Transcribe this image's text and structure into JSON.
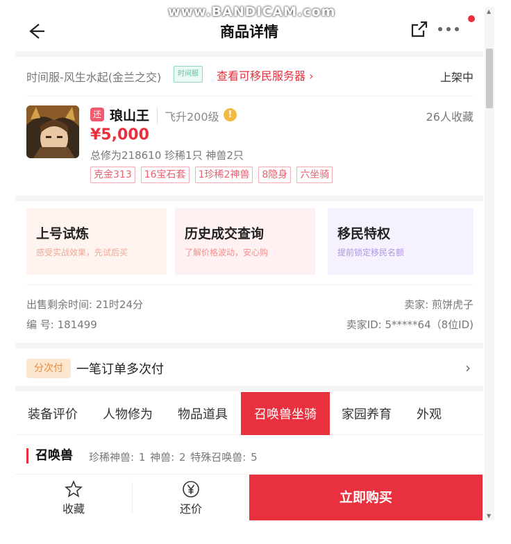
{
  "watermark": "www.BANDICAM.com",
  "header": {
    "title": "商品详情"
  },
  "server": {
    "name": "时间服-风生水起(金兰之交)",
    "tag": "时间服",
    "link": "查看可移民服务器 ›",
    "status": "上架中"
  },
  "product": {
    "return_badge": "还",
    "name": "琅山王",
    "level": "飞升200级",
    "fav_count": "26人收藏",
    "price": "¥5,000",
    "stats": "总修为218610 珍稀1只 神兽2只",
    "tags": [
      "克金313",
      "16宝石套",
      "1珍稀2神兽",
      "8隐身",
      "六坐骑"
    ]
  },
  "cards": [
    {
      "title": "上号试炼",
      "subtitle": "感受实战效果，先试后买"
    },
    {
      "title": "历史成交查询",
      "subtitle": "了解价格波动，安心购"
    },
    {
      "title": "移民特权",
      "subtitle": "提前锁定移民名额"
    }
  ],
  "meta": {
    "remaining": "出售剩余时间: 21时24分",
    "seller": "卖家: 煎饼虎子",
    "number": "编 号: 181499",
    "seller_id": "卖家ID: 5*****64（8位ID)"
  },
  "installment": {
    "badge": "分次付",
    "text": "一笔订单多次付",
    "chevron": "›"
  },
  "tabs": [
    "装备评价",
    "人物修为",
    "物品道具",
    "召唤兽坐骑",
    "家园养育",
    "外观"
  ],
  "section": {
    "title": "召唤兽",
    "stats": "珍稀神兽: 1  神兽: 2  特殊召唤兽: 5"
  },
  "bottom": {
    "favorite": "收藏",
    "bargain": "还价",
    "buy": "立即购买"
  },
  "colors": {
    "accent": "#e8303e",
    "tag_border": "#f2a9b1",
    "install_bg": "#fde6cf"
  },
  "icons": {
    "back": "arrow-left-icon",
    "share": "share-icon",
    "more": "more-icon",
    "favorite": "star-icon",
    "bargain": "yen-icon"
  }
}
